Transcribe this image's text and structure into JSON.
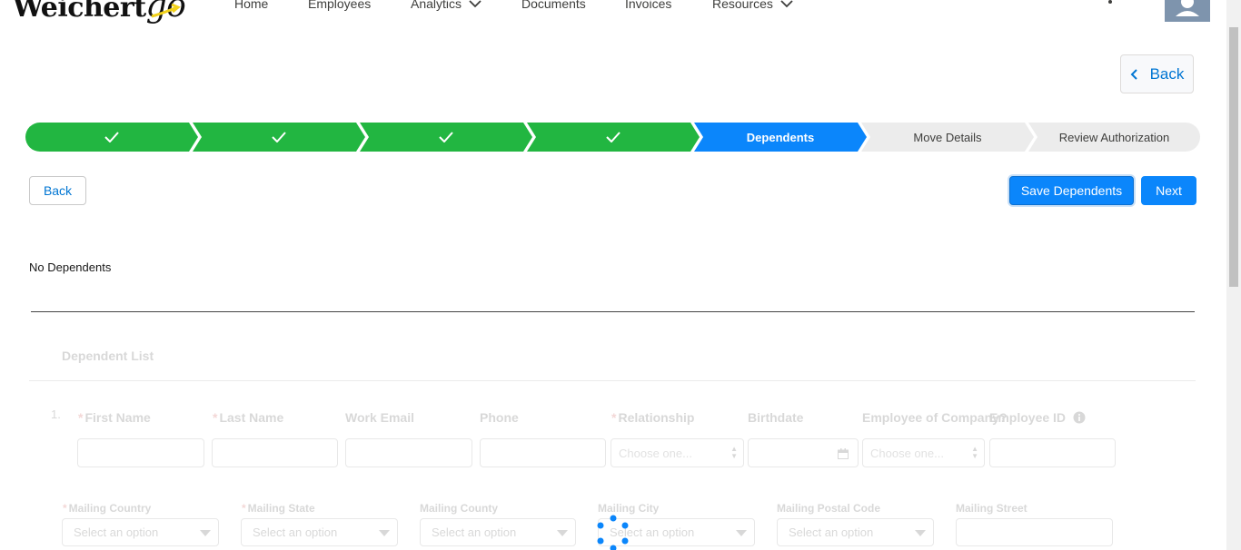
{
  "nav": {
    "logo_text": "Weichert",
    "logo_go": "go",
    "links": [
      "Home",
      "Employees",
      "Analytics",
      "Documents",
      "Invoices",
      "Resources"
    ]
  },
  "top_back_label": "Back",
  "path": {
    "steps": [
      {
        "label": "",
        "state": "complete"
      },
      {
        "label": "",
        "state": "complete"
      },
      {
        "label": "",
        "state": "complete"
      },
      {
        "label": "",
        "state": "complete"
      },
      {
        "label": "Dependents",
        "state": "current"
      },
      {
        "label": "Move Details",
        "state": "incomplete"
      },
      {
        "label": "Review Authorization",
        "state": "incomplete"
      }
    ]
  },
  "actions": {
    "back_label": "Back",
    "save_label": "Save Dependents",
    "next_label": "Next"
  },
  "no_dependents_text": "No Dependents",
  "dependent_list": {
    "title": "Dependent List",
    "row_number": "1.",
    "labels": {
      "first_name": "First Name",
      "last_name": "Last Name",
      "work_email": "Work Email",
      "phone": "Phone",
      "relationship": "Relationship",
      "birthdate": "Birthdate",
      "employee_of_company": "Employee of Company?",
      "employee_id": "Employee ID"
    },
    "relationship_placeholder": "Choose one...",
    "employee_of_company_placeholder": "Choose one...",
    "mailing": {
      "country_label": "Mailing Country",
      "state_label": "Mailing State",
      "county_label": "Mailing County",
      "city_label": "Mailing City",
      "postal_label": "Mailing Postal Code",
      "street_label": "Mailing Street",
      "select_placeholder": "Select an option"
    }
  },
  "colors": {
    "complete": "#22b641",
    "current": "#0b86fb",
    "incomplete": "#ececec",
    "brand": "#0b86fb",
    "link": "#0176d3"
  }
}
